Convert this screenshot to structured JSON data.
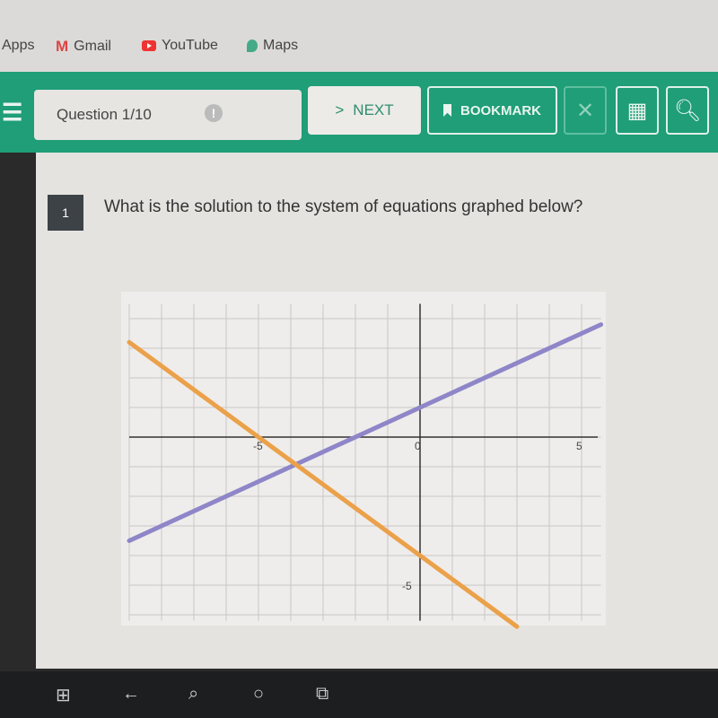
{
  "bookmarks": [
    {
      "label": "Apps",
      "icon": "apps-icon"
    },
    {
      "label": "Gmail",
      "icon": "gmail-icon"
    },
    {
      "label": "YouTube",
      "icon": "youtube-icon"
    },
    {
      "label": "Maps",
      "icon": "maps-icon"
    }
  ],
  "toolbar": {
    "question_label": "Question 1/10",
    "next_label": "NEXT",
    "bookmark_label": "BOOKMARK",
    "accent": "#1f9e78"
  },
  "question": {
    "number": "1",
    "text": "What is the solution to the system of equations graphed below?"
  },
  "chart_data": {
    "type": "line",
    "xlim": [
      -9,
      5.6
    ],
    "ylim": [
      -6.2,
      4.5
    ],
    "grid": true,
    "x_tick_labels": [
      "-5",
      "0",
      "5"
    ],
    "y_tick_labels": [
      "-5"
    ],
    "series": [
      {
        "color": "#8e86c8",
        "slope": 0.5,
        "intercept": 1,
        "x": [
          -9,
          5.6
        ],
        "y": [
          -3.5,
          3.8
        ]
      },
      {
        "color": "#eba14a",
        "slope": -0.8,
        "intercept": -4,
        "x": [
          -9,
          3
        ]
      }
    ]
  },
  "taskbar": [
    "windows-icon",
    "back-icon",
    "search-icon",
    "cortana-icon",
    "task-view-icon"
  ]
}
